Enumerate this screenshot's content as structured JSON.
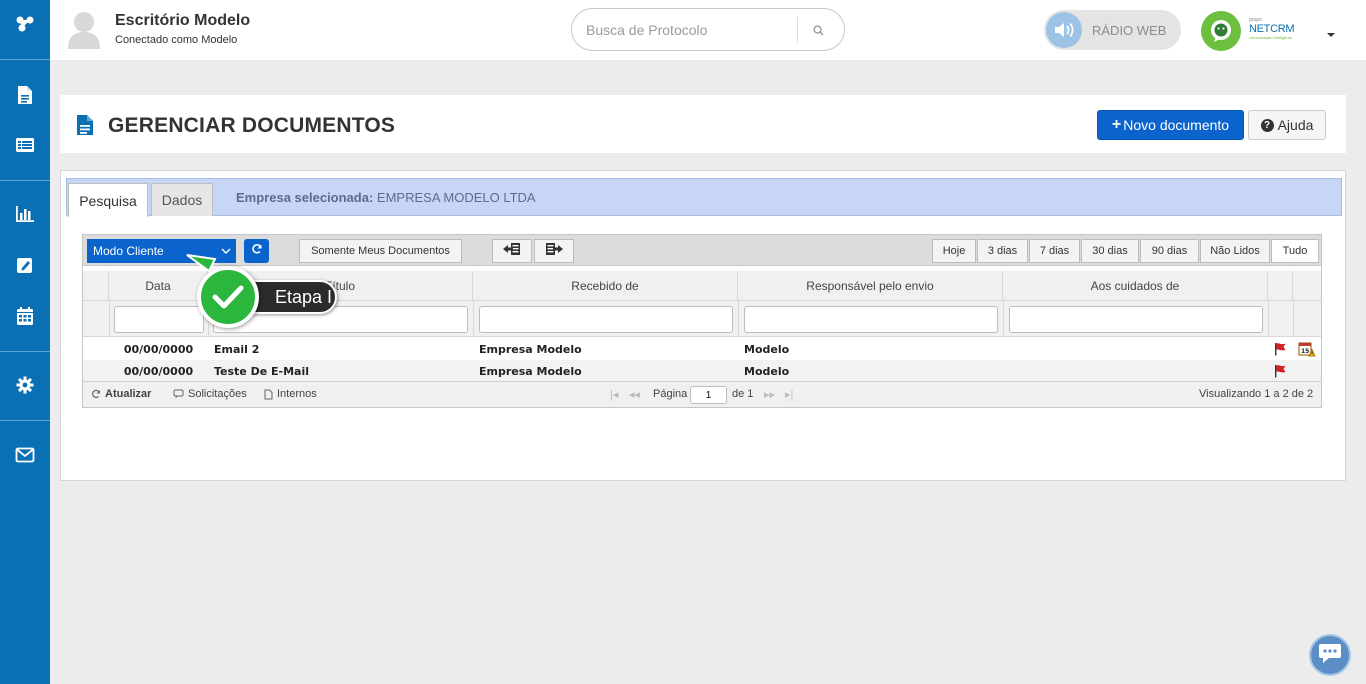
{
  "header": {
    "office_name": "Escritório Modelo",
    "connected_as": "Conectado como Modelo",
    "search": {
      "placeholder": "Busca de Protocolo",
      "value": ""
    },
    "radio_label": "RÁDIO WEB",
    "brand": {
      "small": "grupo",
      "name": "NETCRM",
      "tagline": "comunicação inteligente"
    }
  },
  "sidebar": {
    "items": [
      {
        "name": "brand-logo-icon"
      },
      {
        "name": "documents-icon"
      },
      {
        "name": "list-icon"
      },
      {
        "name": "chart-icon"
      },
      {
        "name": "edit-icon"
      },
      {
        "name": "calendar-icon"
      },
      {
        "name": "gear-icon"
      },
      {
        "name": "mail-icon"
      }
    ],
    "color": "#0a6fb3"
  },
  "page": {
    "title": "GERENCIAR DOCUMENTOS",
    "new_button": "Novo documento",
    "help_button": "Ajuda"
  },
  "tabs": [
    {
      "label": "Pesquisa",
      "active": true
    },
    {
      "label": "Dados",
      "active": false
    }
  ],
  "company": {
    "label": "Empresa selecionada:",
    "value": "EMPRESA MODELO LTDA"
  },
  "toolbar": {
    "mode_select": "Modo Cliente",
    "my_docs": "Somente Meus Documentos",
    "periods": [
      "Hoje",
      "3 dias",
      "7 dias",
      "30 dias",
      "90 dias",
      "Não Lidos",
      "Tudo"
    ],
    "active_period": "Tudo"
  },
  "table": {
    "columns": [
      "Data",
      "Título",
      "Recebido de",
      "Responsável pelo envio",
      "Aos cuidados de"
    ],
    "rows": [
      {
        "data": "00/00/0000",
        "titulo": "Email 2",
        "recebido": "Empresa Modelo",
        "responsavel": "Modelo",
        "cuidados": ""
      },
      {
        "data": "00/00/0000",
        "titulo": "Teste De E-Mail",
        "recebido": "Empresa Modelo",
        "responsavel": "Modelo",
        "cuidados": ""
      }
    ]
  },
  "pager": {
    "refresh": "Atualizar",
    "requests": "Solicitações",
    "internal": "Internos",
    "page_label": "Página",
    "page_value": "1",
    "of_label": "de 1",
    "viewing": "Visualizando 1 a 2 de 2"
  },
  "callout": {
    "text": "Etapa I"
  },
  "colors": {
    "primary": "#0b63cc",
    "tab_bar": "#c8d6f6",
    "step_green": "#2bb63d"
  }
}
